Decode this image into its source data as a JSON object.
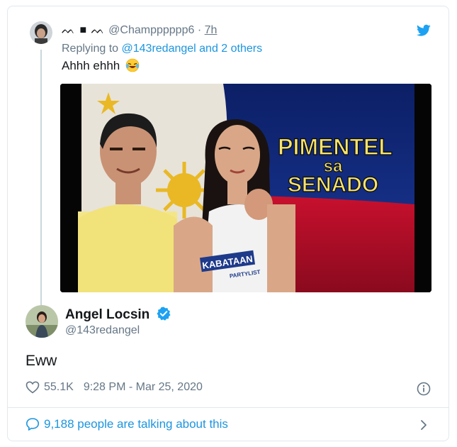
{
  "reply": {
    "display_name_glyph": "ᨓ ■ ᨓ",
    "handle": "@Champppppp6",
    "separator": "·",
    "time": "7h",
    "replying_prefix": "Replying to",
    "replying_to": "@143redangel and 2 others",
    "text": "Ahhh ehhh",
    "media_text": {
      "line1": "PIMENTEL",
      "line2": "sa",
      "line3": "SENADO",
      "shirt_text": "KABATAAN",
      "shirt_sub": "PARTYLIST"
    }
  },
  "tweet": {
    "author_name": "Angel Locsin",
    "author_handle": "@143redangel",
    "text": "Eww",
    "likes": "55.1K",
    "timestamp": "9:28 PM - Mar 25, 2020"
  },
  "footer": {
    "talking": "9,188 people are talking about this"
  },
  "colors": {
    "twitter_blue": "#1da1f2",
    "link_blue": "#1b95e0",
    "secondary_text": "#657786",
    "primary_text": "#14171a"
  }
}
